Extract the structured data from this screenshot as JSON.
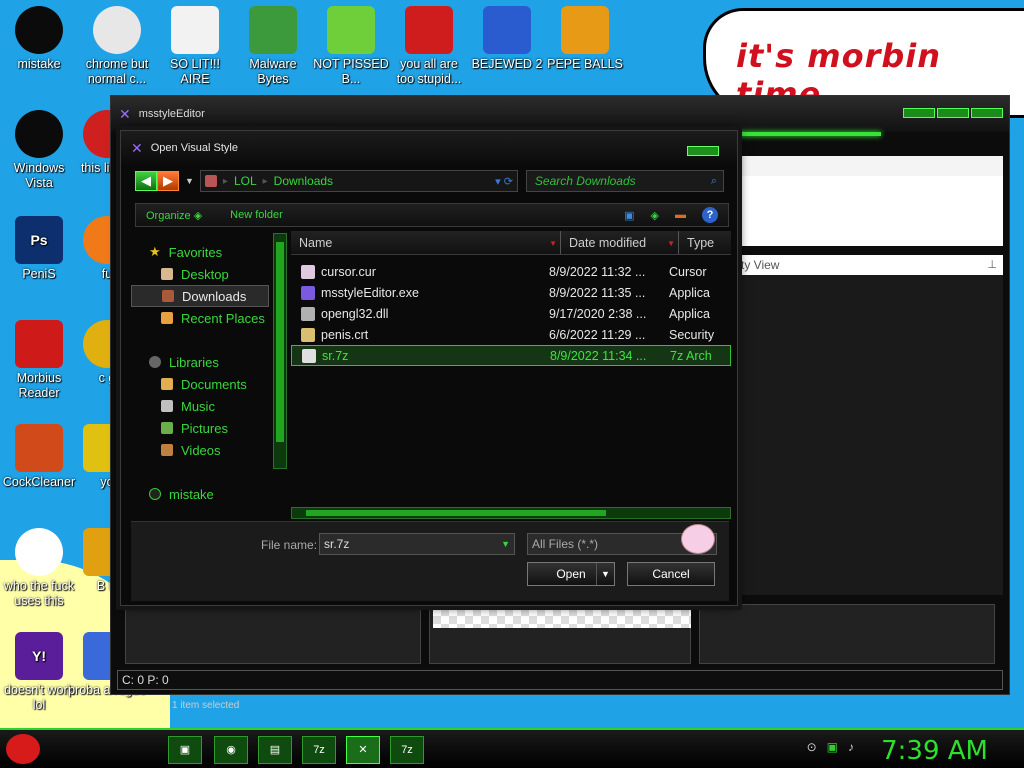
{
  "desktop": {
    "banner_text": "it's morbin time",
    "icons": [
      {
        "label": "mistake",
        "icon": "razer-icon",
        "color": "#0b0b0b"
      },
      {
        "label": "chrome but normal c...",
        "icon": "chrome-icon",
        "color": "#e7e7e7"
      },
      {
        "label": "SO LIT!!! AIRE",
        "icon": "cards-icon",
        "color": "#f2f2f2"
      },
      {
        "label": "Malware Bytes",
        "icon": "shield-icon",
        "color": "#3c9a3c"
      },
      {
        "label": "NOT PISSED B...",
        "icon": "pig-icon",
        "color": "#6fcf3a"
      },
      {
        "label": "you all are too stupid...",
        "icon": "devcpp-icon",
        "color": "#cf1d1d"
      },
      {
        "label": "BEJEWED 2",
        "icon": "bejeweled-icon",
        "color": "#2a5ccf"
      },
      {
        "label": "PEPE BALLS",
        "icon": "pepe-icon",
        "color": "#e69a16"
      },
      {
        "label": "Windows Vista",
        "icon": "razer-icon",
        "color": "#0b0b0b"
      },
      {
        "label": "this like a",
        "icon": "ball-icon",
        "color": "#cf2020"
      },
      {
        "label": "PeniS",
        "icon": "photoshop-icon",
        "color": "#0d2f6e",
        "glyph": "Ps"
      },
      {
        "label": "fu",
        "icon": "firefox-icon",
        "color": "#f07a18"
      },
      {
        "label": "Morbius Reader",
        "icon": "acrobat-icon",
        "color": "#cf1a1a"
      },
      {
        "label": "c g",
        "icon": "coin-icon",
        "color": "#e0b010"
      },
      {
        "label": "CockCleaner",
        "icon": "ccleaner-icon",
        "color": "#d04a1a"
      },
      {
        "label": "yo",
        "icon": "star-icon",
        "color": "#e0c010"
      },
      {
        "label": "who the fuck uses this",
        "icon": "flash-icon",
        "color": "#ffffff"
      },
      {
        "label": "B B",
        "icon": "generic-icon",
        "color": "#e0a010"
      },
      {
        "label": "doesn't work lol",
        "icon": "yahoo-icon",
        "color": "#5a1e9a",
        "glyph": "Y!"
      },
      {
        "label": "proba a rogue",
        "icon": "generic-icon",
        "color": "#3a6ad9"
      }
    ]
  },
  "app": {
    "title": "msstyleEditor",
    "property_view_label": "ty View",
    "status_text": "C: 0 P: 0",
    "below_status": "1 item selected"
  },
  "dialog": {
    "title": "Open Visual Style",
    "breadcrumb": [
      "LOL",
      "Downloads"
    ],
    "search_placeholder": "Search Downloads",
    "toolbar": {
      "organize": "Organize",
      "new_folder": "New folder",
      "help": "?"
    },
    "nav": {
      "favorites": "Favorites",
      "desktop": "Desktop",
      "downloads": "Downloads",
      "recent": "Recent Places",
      "libraries": "Libraries",
      "documents": "Documents",
      "music": "Music",
      "pictures": "Pictures",
      "videos": "Videos",
      "mistake": "mistake"
    },
    "columns": {
      "name": "Name",
      "date": "Date modified",
      "type": "Type"
    },
    "files": [
      {
        "name": "cursor.cur",
        "date": "8/9/2022 11:32 ...",
        "type": "Cursor",
        "color": "#e0c8e0"
      },
      {
        "name": "msstyleEditor.exe",
        "date": "8/9/2022 11:35 ...",
        "type": "Applica",
        "color": "#7a5ae0"
      },
      {
        "name": "opengl32.dll",
        "date": "9/17/2020 2:38 ...",
        "type": "Applica",
        "color": "#b0b0b0"
      },
      {
        "name": "penis.crt",
        "date": "6/6/2022 11:29 ...",
        "type": "Security",
        "color": "#d8c070"
      },
      {
        "name": "sr.7z",
        "date": "8/9/2022 11:34 ...",
        "type": "7z Arch",
        "color": "#e0e0e0"
      }
    ],
    "file_name_label": "File name:",
    "file_name_value": "sr.7z",
    "file_type": "All Files (*.*)",
    "open_label": "Open",
    "cancel_label": "Cancel"
  },
  "taskbar": {
    "clock": "7:39 AM",
    "tasks": [
      {
        "icon": "folder-icon",
        "glyph": "▣"
      },
      {
        "icon": "chrome-icon",
        "glyph": "◉"
      },
      {
        "icon": "editor-icon",
        "glyph": "▤"
      },
      {
        "icon": "7z-icon",
        "glyph": "7z"
      },
      {
        "icon": "msstyle-icon",
        "glyph": "✕"
      },
      {
        "icon": "7z-icon",
        "glyph": "7z"
      }
    ]
  }
}
